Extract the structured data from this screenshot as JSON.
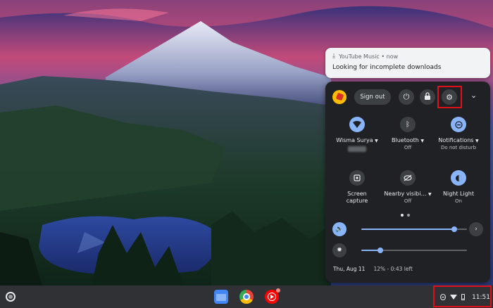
{
  "notification": {
    "source": "YouTube Music • now",
    "message": "Looking for incomplete downloads"
  },
  "quick_settings": {
    "sign_out": "Sign out",
    "tiles": [
      {
        "label": "Wisma Surya",
        "sub": "",
        "state": "on",
        "icon": "wifi-icon"
      },
      {
        "label": "Bluetooth",
        "sub": "Off",
        "state": "off",
        "icon": "bluetooth-icon"
      },
      {
        "label": "Notifications",
        "sub": "Do not disturb",
        "state": "on",
        "icon": "do-not-disturb-icon"
      },
      {
        "label": "Screen capture",
        "sub": "",
        "state": "off",
        "icon": "screen-capture-icon"
      },
      {
        "label": "Nearby visibi…",
        "sub": "Off",
        "state": "off",
        "icon": "nearby-share-icon"
      },
      {
        "label": "Night Light",
        "sub": "On",
        "state": "on",
        "icon": "night-light-icon"
      }
    ],
    "volume_level": 0.88,
    "brightness_level": 0.18,
    "footer": {
      "date": "Thu, Aug 11",
      "battery": "12% - 0:43 left"
    }
  },
  "shelf": {
    "time": "11:51",
    "apps": [
      "files-app-icon",
      "chrome-icon",
      "youtube-music-icon"
    ]
  },
  "colors": {
    "accent": "#8ab4f8",
    "panel": "#202124",
    "highlight": "#e0101a"
  }
}
